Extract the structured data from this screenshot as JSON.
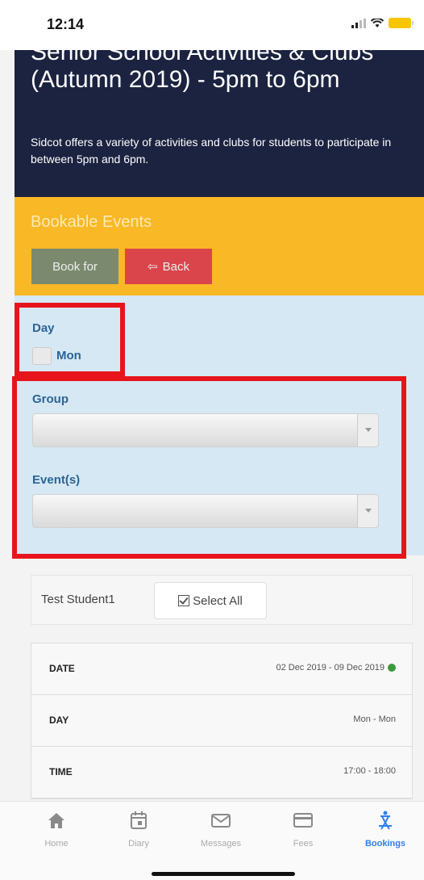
{
  "status_bar": {
    "time": "12:14",
    "battery_color": "#f7c600"
  },
  "header": {
    "title": "Senior School Activities & Clubs (Autumn 2019) - 5pm to 6pm",
    "description": "Sidcot offers a variety of activities and clubs for students to participate in between 5pm and 6pm."
  },
  "bookable": {
    "title": "Bookable Events",
    "book_button": "Book for",
    "back_button": "Back",
    "back_icon": "back-arrow-icon"
  },
  "form": {
    "day_label": "Day",
    "day_option": "Mon",
    "day_checked": false,
    "group_label": "Group",
    "group_value": "",
    "events_label": "Event(s)",
    "events_value": ""
  },
  "student": {
    "name": "Test Student1",
    "select_all_label": "Select All"
  },
  "info_rows": [
    {
      "key": "DATE",
      "value": "02 Dec 2019 - 09 Dec 2019",
      "status_color": "#3c9a3c"
    },
    {
      "key": "DAY",
      "value": "Mon - Mon"
    },
    {
      "key": "TIME",
      "value": "17:00 - 18:00"
    }
  ],
  "tabs": [
    {
      "label": "Home",
      "icon": "home-icon",
      "active": false
    },
    {
      "label": "Diary",
      "icon": "calendar-icon",
      "active": false
    },
    {
      "label": "Messages",
      "icon": "envelope-icon",
      "active": false
    },
    {
      "label": "Fees",
      "icon": "credit-card-icon",
      "active": false
    },
    {
      "label": "Bookings",
      "icon": "bookings-icon",
      "active": true
    }
  ],
  "colors": {
    "header_bg": "#1b2340",
    "bookable_bg": "#f9b826",
    "book_btn": "#7b8a6e",
    "back_btn": "#d9454b",
    "form_bg": "#d6e8f4",
    "highlight": "#e8141c",
    "active_tab": "#2f80ed"
  }
}
